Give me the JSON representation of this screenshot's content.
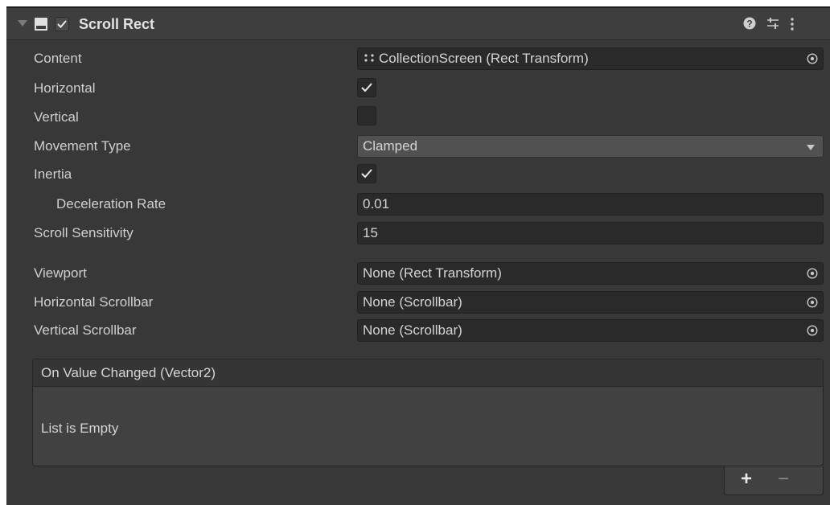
{
  "component": {
    "title": "Scroll Rect",
    "enabled": true
  },
  "fields": {
    "content": {
      "label": "Content",
      "value": "CollectionScreen (Rect Transform)"
    },
    "horizontal": {
      "label": "Horizontal",
      "checked": true
    },
    "vertical": {
      "label": "Vertical",
      "checked": false
    },
    "movement_type": {
      "label": "Movement Type",
      "value": "Clamped"
    },
    "inertia": {
      "label": "Inertia",
      "checked": true
    },
    "deceleration_rate": {
      "label": "Deceleration Rate",
      "value": "0.01"
    },
    "scroll_sensitivity": {
      "label": "Scroll Sensitivity",
      "value": "15"
    },
    "viewport": {
      "label": "Viewport",
      "value": "None (Rect Transform)"
    },
    "horizontal_scrollbar": {
      "label": "Horizontal Scrollbar",
      "value": "None (Scrollbar)"
    },
    "vertical_scrollbar": {
      "label": "Vertical Scrollbar",
      "value": "None (Scrollbar)"
    }
  },
  "event": {
    "title": "On Value Changed (Vector2)",
    "empty_text": "List is Empty",
    "add_label": "+",
    "remove_label": "−"
  },
  "icons": [
    "foldout-arrow-icon",
    "component-icon",
    "help-icon",
    "presets-icon",
    "menu-icon",
    "rect-transform-icon",
    "object-picker-icon",
    "dropdown-arrow-icon",
    "checkmark-icon"
  ],
  "colors": {
    "background": "#383838",
    "field": "#2a2a2a",
    "header": "#3e3e3e"
  }
}
